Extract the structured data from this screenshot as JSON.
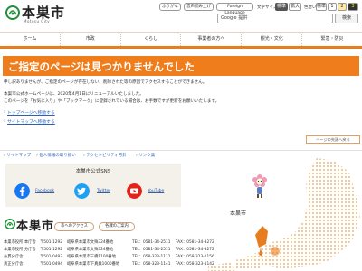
{
  "header": {
    "logo_text": "本巣市",
    "logo_sub": "Motosu City",
    "furigana": "ふりがな",
    "voice": "音声読み上げ",
    "language": "Foreign Language",
    "size_label": "文字サイズ",
    "size_std": "標準",
    "size_large": "拡大",
    "color_label": "色合い",
    "color_std": "標準",
    "color_1": "1",
    "color_2": "2",
    "color_3": "3",
    "search_placeholder": "Google 提供",
    "search_button": "検索"
  },
  "nav": [
    "ホーム",
    "市政",
    "くらし",
    "事業者の方へ",
    "観光・文化",
    "緊急・防災"
  ],
  "main": {
    "title": "ご指定のページは見つかりませんでした",
    "p1": "申し訳ありませんが、ご指定のページが存在しない、削除された等の原因でアクセスすることができません。",
    "p2": "本巣市公式ホームページは、2020年4月1日にリニューアルいたしました。",
    "p3": "このページを「お気に入り」や「ブックマーク」に登録されている場合は、お手数ですが更新をお願いいたします。",
    "link_top": "トップページへ移動する",
    "link_sitemap": "サイトマップへ移動する",
    "prev_button": "ページの先頭へ戻る"
  },
  "utility_links": [
    "サイトマップ",
    "個人情報の取り扱い",
    "アクセシビリティ方針",
    "リンク集"
  ],
  "sns": {
    "title": "本巣市公式SNS",
    "facebook": "Facebook",
    "twitter": "Twitter",
    "youtube": "YouTube"
  },
  "footer": {
    "logo_text": "本巣市",
    "access": "市へのアクセス",
    "guide": "各課のご案内",
    "offices": [
      {
        "name": "本巣市役所 本庁舎",
        "zip": "〒501-1292",
        "addr": "岐阜県本巣市文殊324番地",
        "tel": "TEL：0581-34-2511",
        "fax": "FAX：0581-34-3272"
      },
      {
        "name": "本巣市役所 分庁舎",
        "zip": "〒501-1292",
        "addr": "岐阜県本巣市文殊324番地",
        "tel": "TEL：0581-34-2511",
        "fax": "FAX：0581-34-3272"
      },
      {
        "name": "糸貫分庁舎",
        "zip": "〒501-0493",
        "addr": "岐阜県本巣市三橋1100番地",
        "tel": "TEL：058-323-1111",
        "fax": "FAX：058-323-1156"
      },
      {
        "name": "真正分庁舎",
        "zip": "〒501-0494",
        "addr": "岐阜県本巣市下真桑1000番地",
        "tel": "TEL：058-323-1141",
        "fax": "FAX：058-323-1142"
      }
    ],
    "map_label": "本巣市"
  },
  "colors": {
    "accent": "#ef7d1c",
    "link": "#2d5fb5",
    "facebook": "#1877f2",
    "twitter": "#1da1f2",
    "youtube": "#e62117",
    "map_land": "#f2c48e",
    "map_city": "#e77d1e"
  }
}
